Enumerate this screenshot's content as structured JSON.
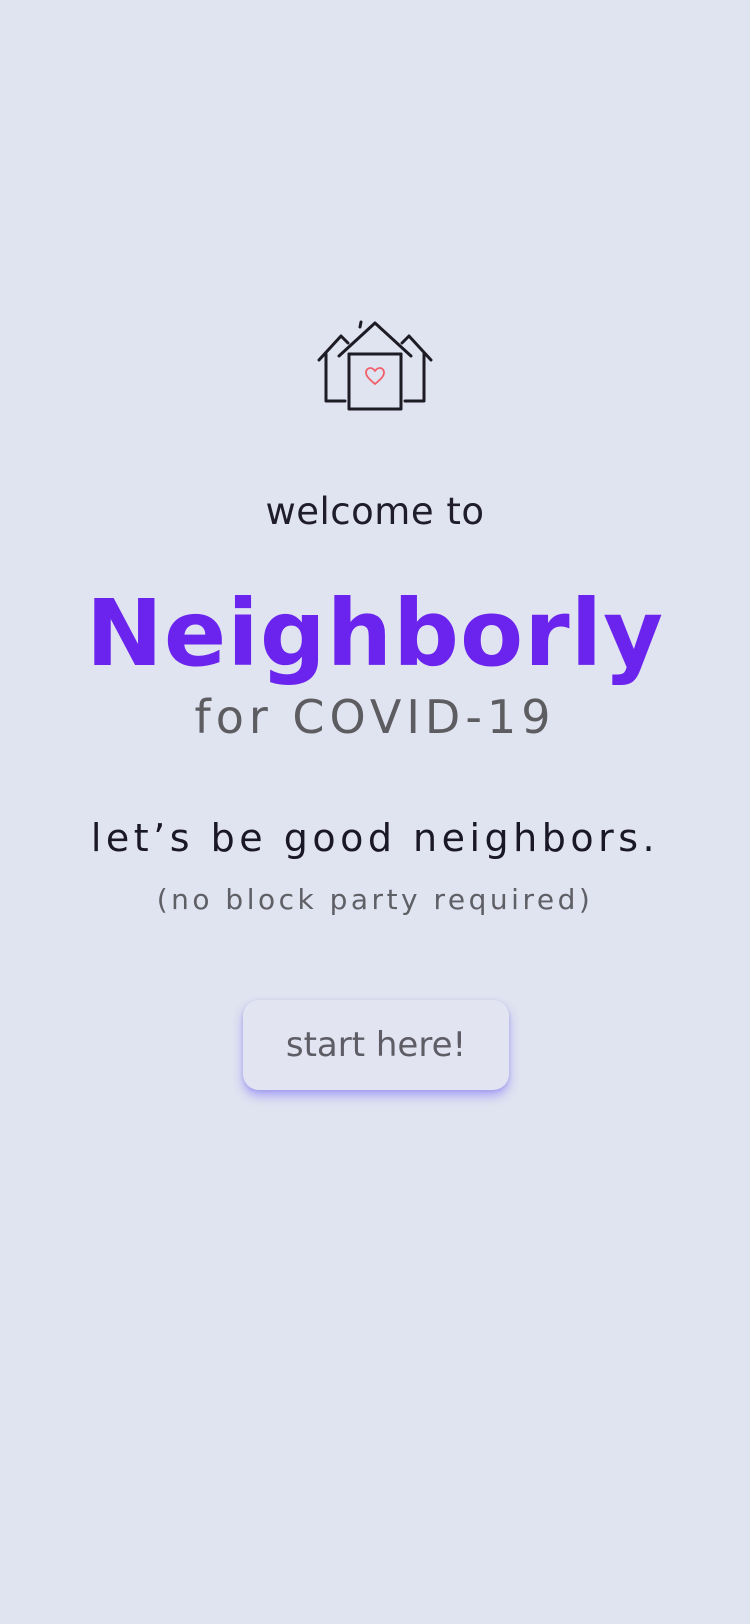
{
  "welcome": {
    "intro": "welcome to",
    "app_name": "Neighborly",
    "subtitle": "for COVID-19",
    "tagline": "let’s be good neighbors.",
    "tagline_sub": "(no block party required)",
    "start_button": "start here!"
  },
  "logo": {
    "icon": "house-heart-icon",
    "heart_color": "#f0606a"
  },
  "colors": {
    "background": "#e0e3f0",
    "accent": "#6a24ee",
    "button_shadow": "#6a5aff"
  }
}
